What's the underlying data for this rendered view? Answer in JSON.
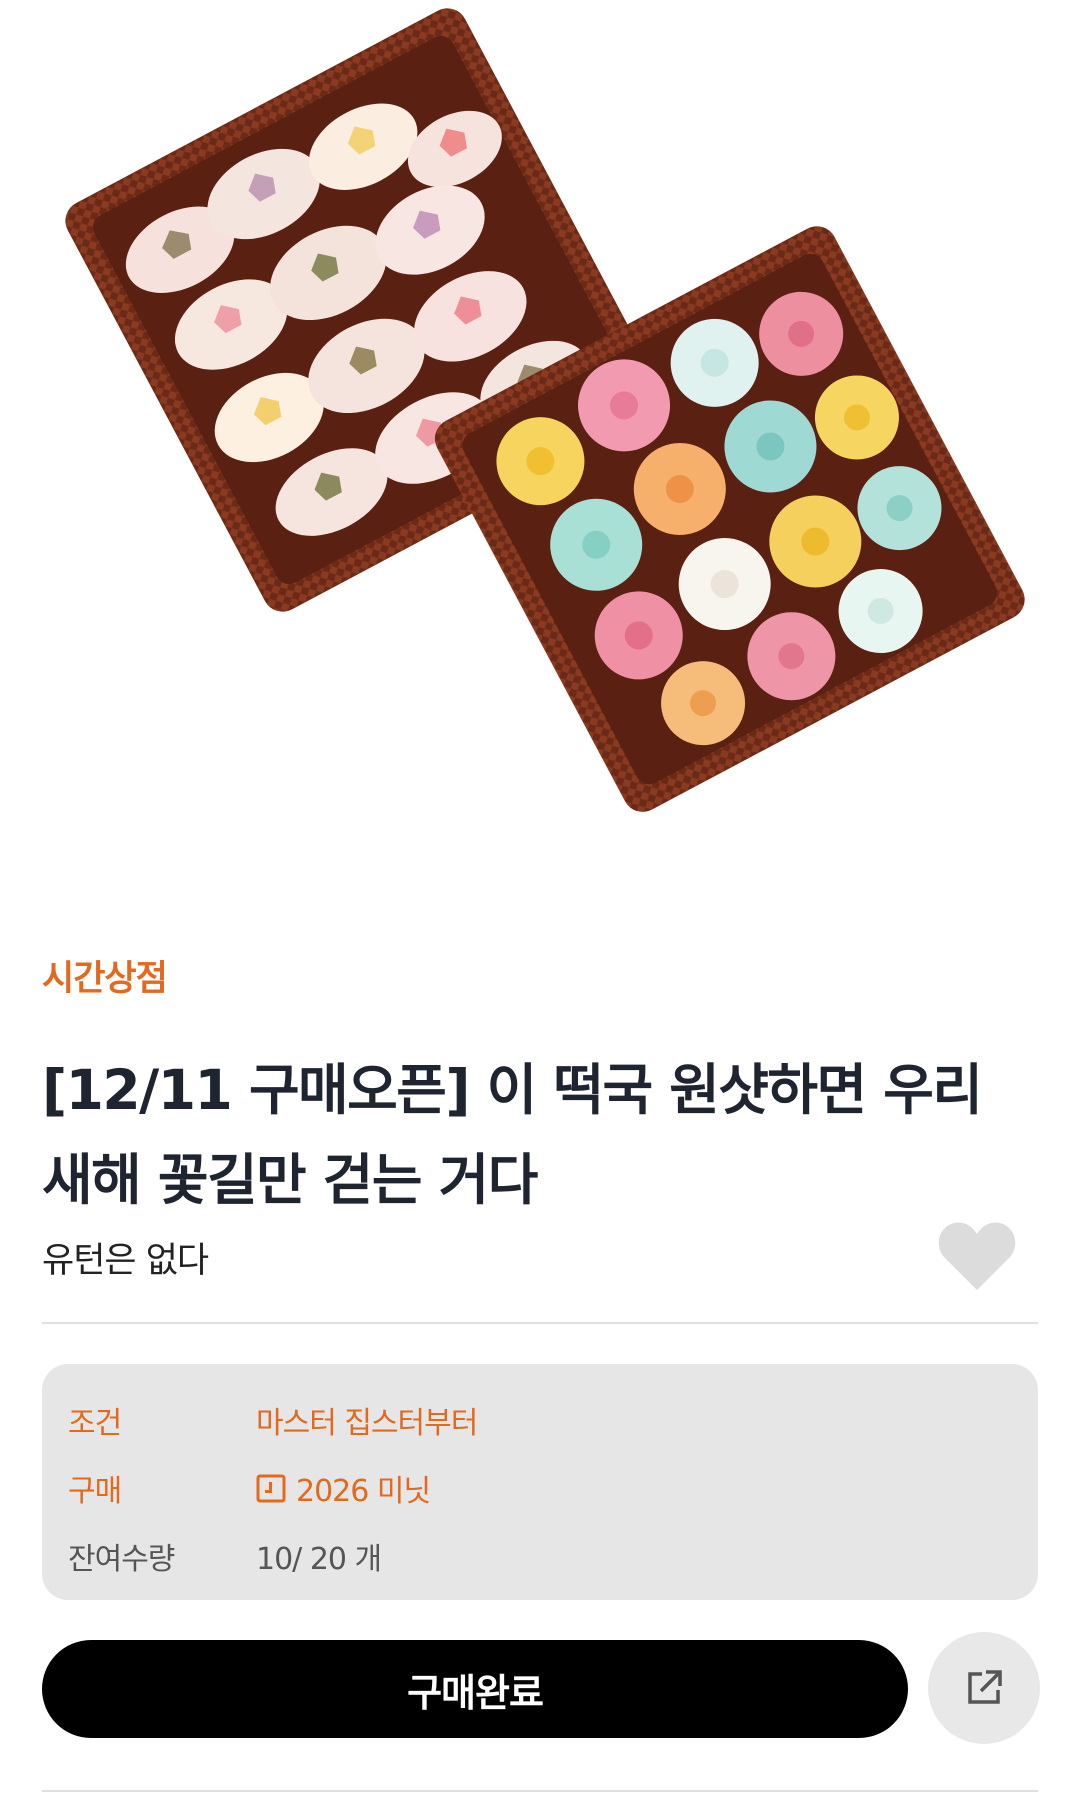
{
  "product": {
    "category": "시간상점",
    "title": "[12/11 구매오픈] 이 떡국 원샷하면 우리 새해 꽃길만 걷는 거다",
    "subtitle": "유턴은 없다"
  },
  "info": {
    "condition_label": "조건",
    "condition_value": "마스터 집스터부터",
    "price_label": "구매",
    "price_value": "2026 미닛",
    "stock_label": "잔여수량",
    "stock_value": "10/ 20 개"
  },
  "actions": {
    "buy_label": "구매완료"
  },
  "icons": {
    "favorite": "heart-icon",
    "share": "share-external-icon",
    "price": "calendar-icon"
  },
  "colors": {
    "accent": "#e2691d",
    "button": "#000000",
    "info_bg": "#e6e6e6"
  }
}
